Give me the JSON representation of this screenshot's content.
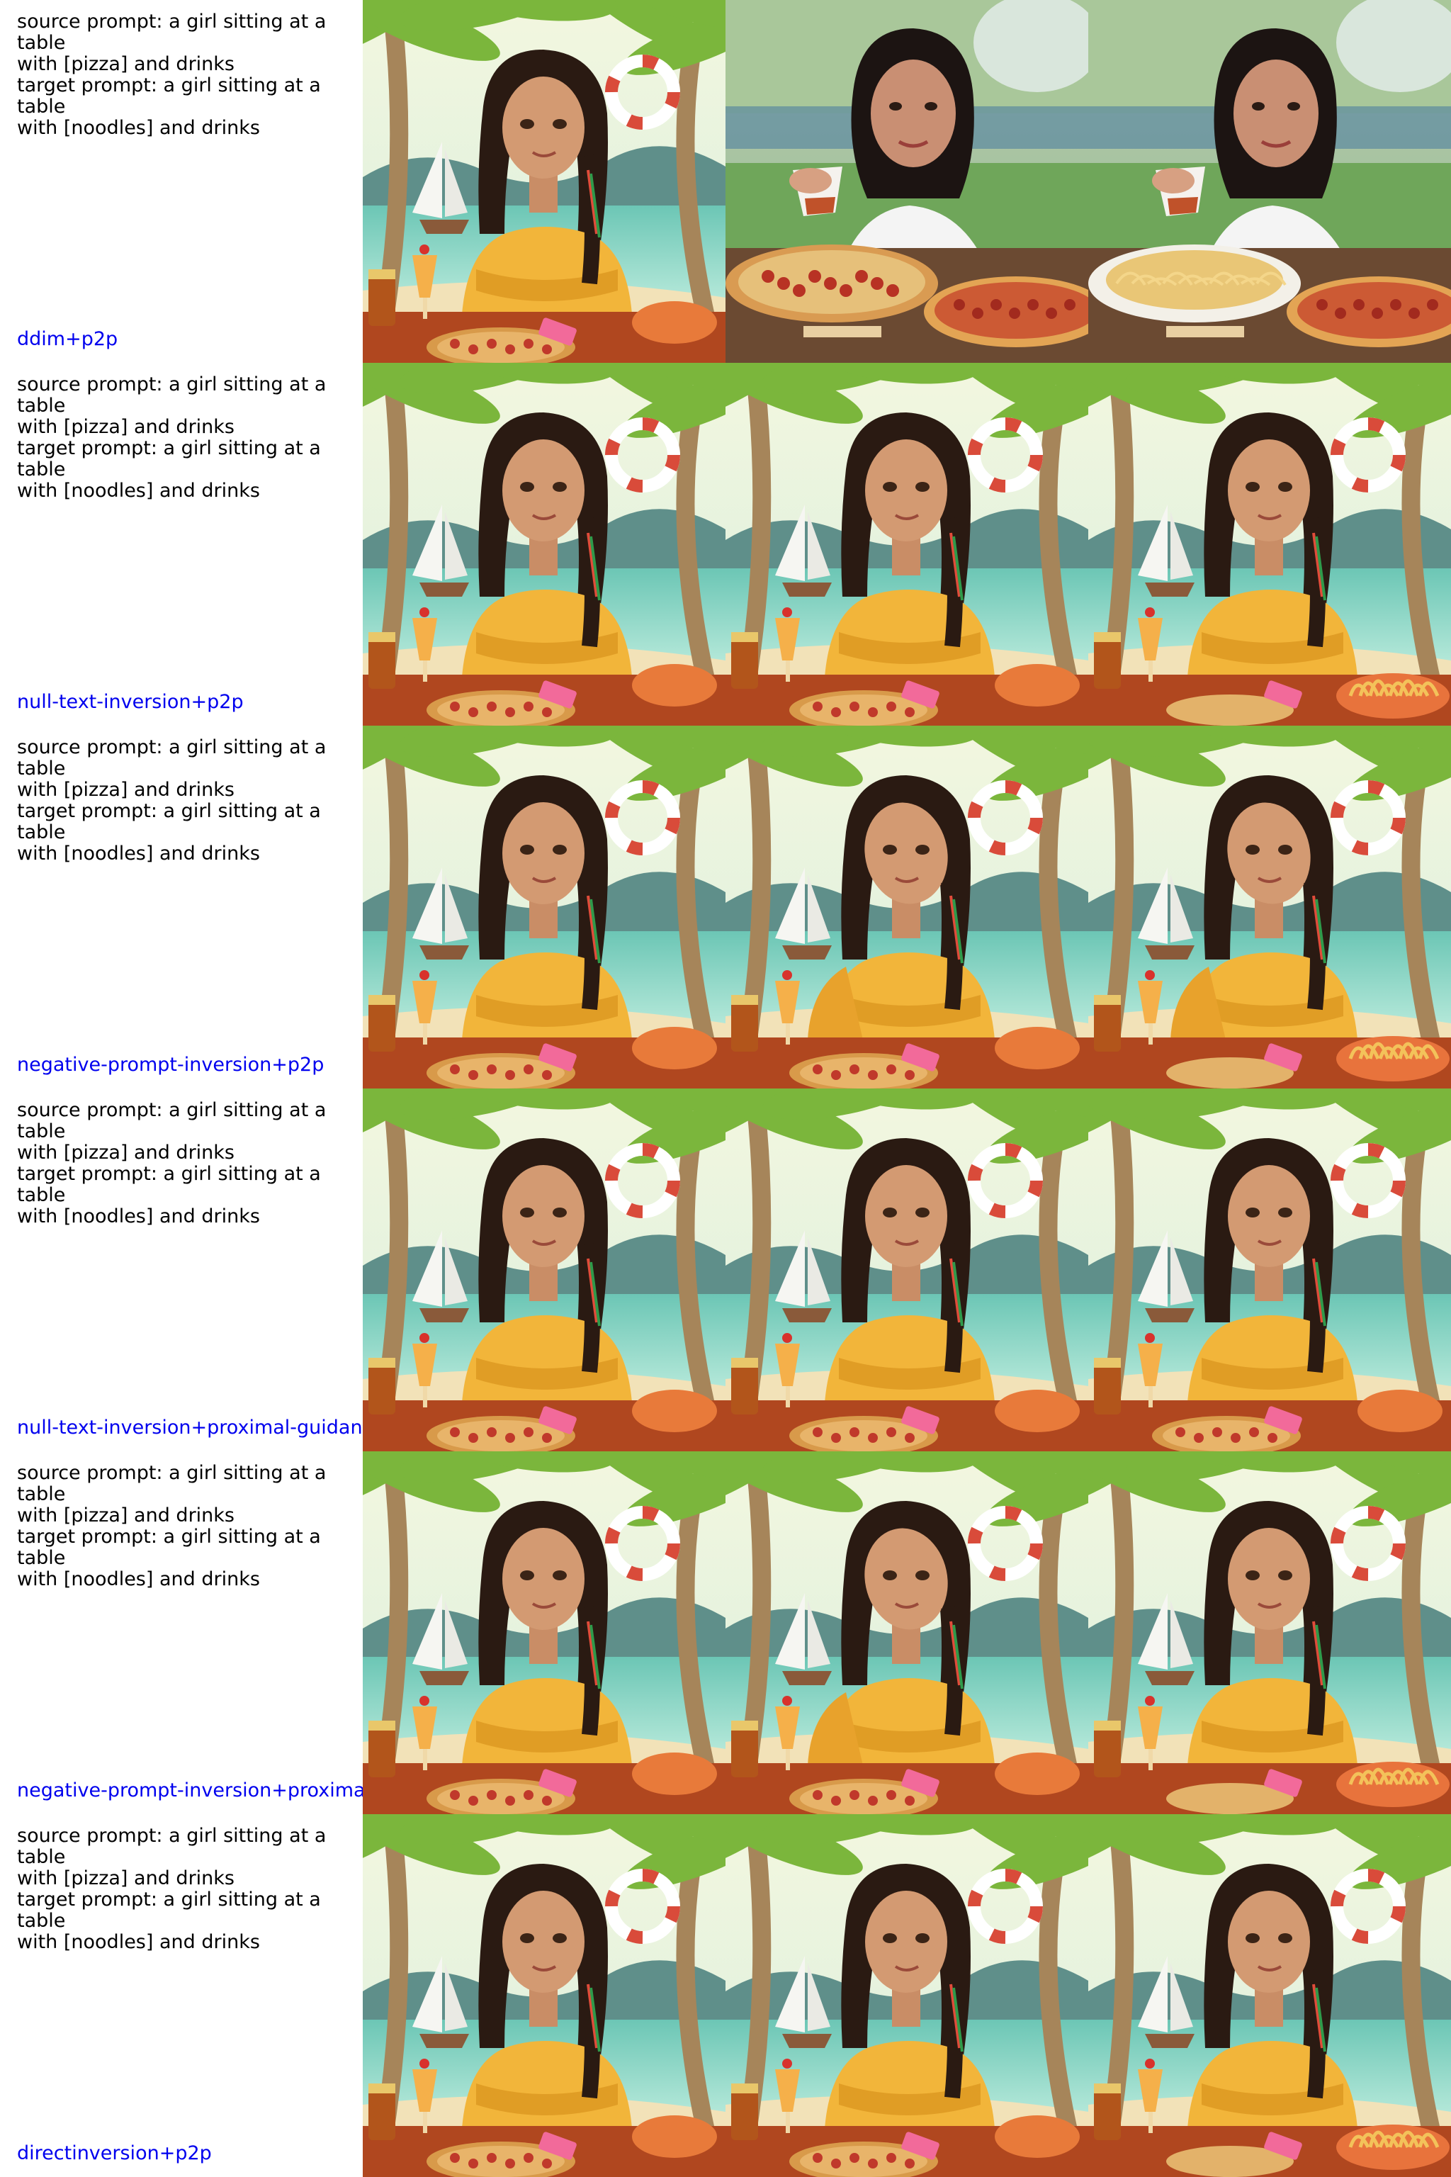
{
  "rows": [
    {
      "source_label": "source prompt: a girl sitting at a table",
      "source_cont": "with [pizza] and drinks",
      "target_label": "target prompt: a girl sitting at a table",
      "target_cont": "with [noodles] and drinks",
      "method": "ddim+p2p",
      "images": [
        "cartoon-girl-beach-pizza",
        "photo-girl-pizza-drink",
        "photo-girl-noodles-pizza"
      ]
    },
    {
      "source_label": "source prompt: a girl sitting at a table",
      "source_cont": "with [pizza] and drinks",
      "target_label": "target prompt: a girl sitting at a table",
      "target_cont": "with [noodles] and drinks",
      "method": "null-text-inversion+p2p",
      "images": [
        "cartoon-girl-beach-pizza",
        "cartoon-girl-beach-pizza",
        "cartoon-girl-beach-noodles"
      ]
    },
    {
      "source_label": "source prompt: a girl sitting at a table",
      "source_cont": "with [pizza] and drinks",
      "target_label": "target prompt: a girl sitting at a table",
      "target_cont": "with [noodles] and drinks",
      "method": "negative-prompt-inversion+p2p",
      "images": [
        "cartoon-girl-beach-pizza",
        "cartoon-girl-beach-distorted",
        "cartoon-girl-beach-noodles-distorted"
      ]
    },
    {
      "source_label": "source prompt: a girl sitting at a table",
      "source_cont": "with [pizza] and drinks",
      "target_label": "target prompt: a girl sitting at a table",
      "target_cont": "with [noodles] and drinks",
      "method": "null-text-inversion+proximal-guidance",
      "images": [
        "cartoon-girl-beach-pizza",
        "cartoon-girl-beach-pizza",
        "cartoon-girl-beach-pizza"
      ]
    },
    {
      "source_label": "source prompt: a girl sitting at a table",
      "source_cont": "with [pizza] and drinks",
      "target_label": "target prompt: a girl sitting at a table",
      "target_cont": "with [noodles] and drinks",
      "method": "negative-prompt-inversion+proximal-guidance",
      "images": [
        "cartoon-girl-beach-pizza",
        "cartoon-girl-beach-distorted",
        "cartoon-girl-beach-noodles"
      ]
    },
    {
      "source_label": "source prompt: a girl sitting at a table",
      "source_cont": "with [pizza] and drinks",
      "target_label": "target prompt: a girl sitting at a table",
      "target_cont": "with [noodles] and drinks",
      "method": "directinversion+p2p",
      "images": [
        "cartoon-girl-beach-pizza",
        "cartoon-girl-beach-pizza",
        "cartoon-girl-beach-noodles"
      ]
    }
  ],
  "colors": {
    "method_label": "#0000ee",
    "prompt_text": "#000000"
  }
}
